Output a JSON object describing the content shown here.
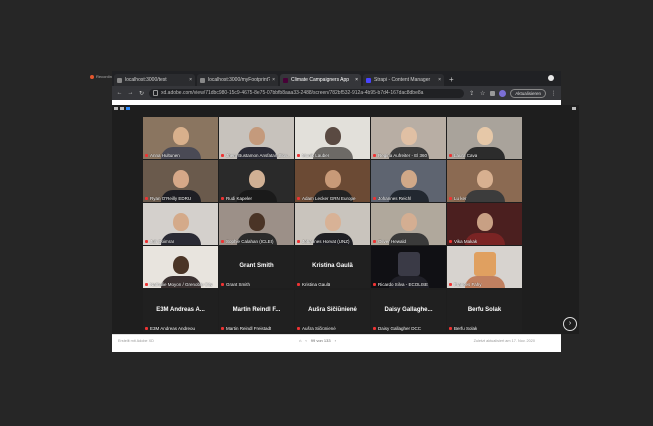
{
  "desktop": {
    "app_label": "Recording"
  },
  "browser": {
    "tabs": [
      {
        "title": "localhost:3000/test",
        "active": false
      },
      {
        "title": "localhost:3000/myFootprint?n",
        "active": false
      },
      {
        "title": "Climate Campaigners App",
        "active": true
      },
      {
        "title": "Strapi - Content Manager",
        "active": false
      }
    ],
    "new_tab": "+",
    "url": "xd.adobe.com/view/71dbc980-15c9-4675-8e75-07bbfb8aaa33-2488/screen/782bf532-912a-4b95-b7d4-167dac8dbe8a",
    "update_label": "Aktualisieren"
  },
  "participants": [
    {
      "name": "Anna Hultunen",
      "kind": "video",
      "bg": "#8a7560",
      "head": "#d8b08c",
      "body": "#4a4a55"
    },
    {
      "name": "Jhem Bustamon Ansfatan Slov...",
      "kind": "video",
      "bg": "#c7c2bc",
      "head": "#c49a7c",
      "body": "#2b2b36"
    },
    {
      "name": "Monik Lauber",
      "kind": "video",
      "bg": "#e2e0da",
      "head": "#5a4a42",
      "body": "#6d6a66"
    },
    {
      "name": "Regina Aufreiter - El 360",
      "kind": "video",
      "bg": "#b8aea4",
      "head": "#e0c0a4",
      "body": "#3a3a3a"
    },
    {
      "name": "Laura Cava",
      "kind": "video",
      "bg": "#a9a39b",
      "head": "#e6c8a8",
      "body": "#2c2c2c"
    },
    {
      "name": "Ryan O'Reilly EDRU",
      "kind": "video",
      "bg": "#6a5a4c",
      "head": "#d6a888",
      "body": "#1e1e24"
    },
    {
      "name": "Rudi Kapeler",
      "kind": "video",
      "bg": "#2a2a2a",
      "head": "#d0b094",
      "body": "#1a1a1a"
    },
    {
      "name": "Adam Lecker GRN Europe",
      "kind": "video",
      "bg": "#6b4a34",
      "head": "#c89a78",
      "body": "#222"
    },
    {
      "name": "Johannes Reichl",
      "kind": "video",
      "bg": "#5e6470",
      "head": "#d0a888",
      "body": "#222830"
    },
    {
      "name": "Lu ker",
      "kind": "video",
      "bg": "#8b6a52",
      "head": "#d8b090",
      "body": "#3c3c3c"
    },
    {
      "name": "Juli Qoimrar",
      "kind": "video",
      "bg": "#d4d0cc",
      "head": "#d4aa8a",
      "body": "#2a2a34"
    },
    {
      "name": "Sophie Calahan (ICLEI)",
      "kind": "video",
      "bg": "#9c9088",
      "head": "#4a3426",
      "body": "#2b2b2b"
    },
    {
      "name": "Johannes Horvat (UNZ)",
      "kind": "video",
      "bg": "#c9c4bd",
      "head": "#d8b296",
      "body": "#1f1f24"
    },
    {
      "name": "Oliver Hewald",
      "kind": "video",
      "bg": "#b0a89c",
      "head": "#d4ae92",
      "body": "#3a3a3a"
    },
    {
      "name": "Vika Makak",
      "kind": "video",
      "bg": "#4b1f1f",
      "head": "#c8a084",
      "body": "#7a2424"
    },
    {
      "name": "Nathalie Moyon / Grenoble City",
      "kind": "video",
      "bg": "#e8e4de",
      "head": "#4a3426",
      "body": "#3a3030"
    },
    {
      "name": "Grant Smith",
      "kind": "text",
      "big": "Grant Smith"
    },
    {
      "name": "Kristina Gaulä",
      "kind": "text",
      "big": "Kristina Gaulä"
    },
    {
      "name": "Ricardo Silva - ECOLISE",
      "kind": "image",
      "bg": "#101014",
      "head": "#3a3a46",
      "body": "#202028"
    },
    {
      "name": "Frances Fahy",
      "kind": "image",
      "bg": "#d7d3cf",
      "head": "#e0a060",
      "body": "#c08060"
    },
    {
      "name": "E3M Andreas Andreou",
      "kind": "text",
      "big": "E3M Andreas A..."
    },
    {
      "name": "Martin Reindl Freistadt",
      "kind": "text",
      "big": "Martin Reindl F..."
    },
    {
      "name": "Aušra Sičiūnienė",
      "kind": "text",
      "big": "Aušra Sičiūnienė"
    },
    {
      "name": "Daisy Gallagher DCC",
      "kind": "text",
      "big": "Daisy Gallaghe..."
    },
    {
      "name": "Berfu Solak",
      "kind": "text",
      "big": "Berfu Solak"
    }
  ],
  "footer": {
    "left": "Erstellt mit Adobe XD",
    "page": "99 von 133",
    "right": "Zuletzt aktualisiert am 17. Nov. 2020"
  },
  "icons": [
    "recording-dot-icon",
    "back-icon",
    "forward-icon",
    "reload-icon",
    "lock-icon",
    "star-icon",
    "next-page-icon",
    "mic-muted-icon"
  ]
}
